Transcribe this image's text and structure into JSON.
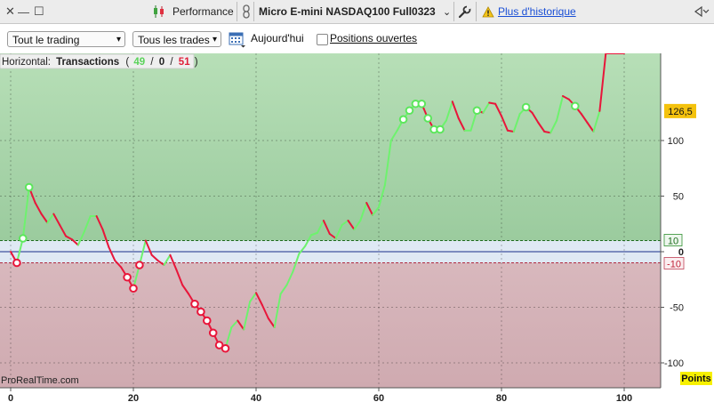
{
  "window": {
    "close_glyph": "✕",
    "min_glyph": "—",
    "max_glyph": "☐",
    "performance_label": "Performance",
    "instrument": "Micro E-mini NASDAQ100 Full0323",
    "instrument_caret": "⌄",
    "history_link": "Plus d'historique"
  },
  "toolbar": {
    "scope_select": "Tout le trading",
    "trades_select": "Tous les trades",
    "date_label": "Aujourd'hui",
    "open_positions_label": "Positions ouvertes",
    "open_positions_checked": false
  },
  "chart_data": {
    "type": "line",
    "header": {
      "prefix": "Horizontal:",
      "title": "Transactions",
      "open": "(",
      "wins": "49",
      "slash1": "/",
      "neutral": "0",
      "slash2": "/",
      "losses": "51",
      "close": ")"
    },
    "watermark": "ProRealTime.com",
    "x_ticks": [
      "0",
      "20",
      "40",
      "60",
      "80",
      "100"
    ],
    "y_ticks": [
      "100",
      "50",
      "0",
      "-50",
      "-100"
    ],
    "y_unit_label": "Points",
    "last_value_label": "126,5",
    "upper_band_label": "10",
    "lower_band_label": "-10",
    "xlim": [
      0,
      105
    ],
    "ylim": [
      -110,
      143
    ],
    "upper_band": 10,
    "lower_band": -10,
    "last_value": 126.5,
    "x": [
      0,
      1,
      2,
      3,
      4,
      5,
      6,
      7,
      8,
      9,
      10,
      11,
      12,
      13,
      14,
      15,
      16,
      17,
      18,
      19,
      20,
      21,
      22,
      23,
      24,
      25,
      26,
      27,
      28,
      29,
      30,
      31,
      32,
      33,
      34,
      35,
      36,
      37,
      38,
      39,
      40,
      41,
      42,
      43,
      44,
      45,
      46,
      47,
      48,
      49,
      50,
      51,
      52,
      53,
      54,
      55,
      56,
      57,
      58,
      59,
      60,
      61,
      62,
      63,
      64,
      65,
      66,
      67,
      68,
      69,
      70,
      71,
      72,
      73,
      74,
      75,
      76,
      77,
      78,
      79,
      80,
      81,
      82,
      83,
      84,
      85,
      86,
      87,
      88,
      89,
      90,
      91,
      92,
      93,
      94,
      95,
      96,
      97,
      98,
      99,
      100
    ],
    "y": [
      0,
      -10,
      12,
      58,
      44,
      34,
      26,
      34,
      24,
      14,
      11,
      6,
      18,
      32,
      32,
      20,
      4,
      -8,
      -14,
      -23,
      -33,
      -12,
      10,
      -3,
      -8,
      -12,
      -3,
      -16,
      -30,
      -38,
      -47,
      -54,
      -62,
      -73,
      -84,
      -87,
      -68,
      -62,
      -70,
      -45,
      -37,
      -48,
      -60,
      -68,
      -38,
      -30,
      -18,
      -2,
      5,
      15,
      17,
      28,
      16,
      12,
      24,
      28,
      20,
      28,
      44,
      33,
      40,
      60,
      100,
      109,
      119,
      127,
      133,
      133,
      120,
      110,
      110,
      118,
      135,
      120,
      109,
      109,
      127,
      125,
      134,
      133,
      122,
      109,
      108,
      124,
      130,
      125,
      116,
      108,
      107,
      118,
      140,
      137,
      131,
      124,
      116,
      108,
      126.5
    ],
    "markers_win": [
      3,
      64,
      65,
      66,
      67,
      68,
      69,
      70,
      76,
      84,
      92,
      2
    ],
    "markers_loss": [
      1,
      19,
      20,
      21,
      30,
      31,
      32,
      33,
      34,
      35
    ]
  }
}
